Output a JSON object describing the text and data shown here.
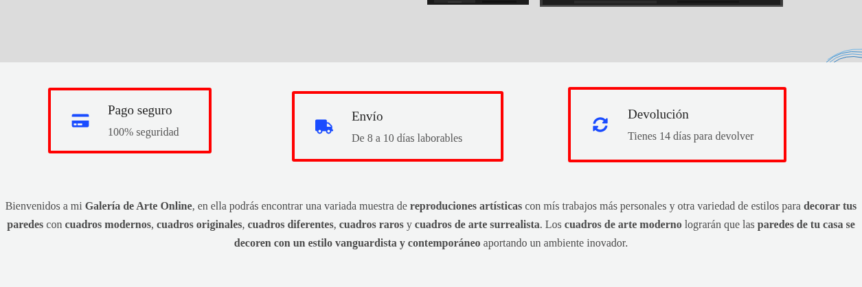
{
  "features": [
    {
      "title": "Pago seguro",
      "subtitle": "100% seguridad"
    },
    {
      "title": "Envío",
      "subtitle": "De 8 a 10 días laborables"
    },
    {
      "title": "Devolución",
      "subtitle": "Tienes 14 días para devolver"
    }
  ],
  "intro": "Bienvenidos a mi **Galería de Arte Online**, en ella podrás encontrar una variada muestra de **reproduciones artísticas** con mís trabajos más personales y otra variedad de estilos para **decorar tus paredes** con **cuadros modernos**, **cuadros originales**, **cuadros diferentes**, **cuadros raros** y **cuadros de arte surrealista**. Los **cuadros de arte moderno** lograrán que las **paredes de tu casa se decoren con un estilo vanguardista y contemporáneo** aportando un ambiente inovador."
}
